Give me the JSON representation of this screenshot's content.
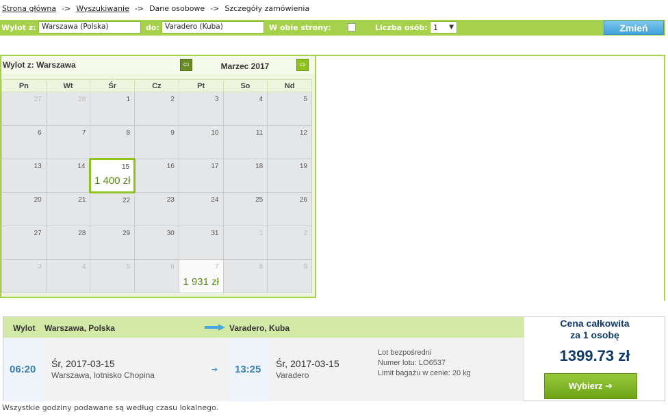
{
  "breadcrumb": {
    "home": "Strona główna",
    "search": "Wyszukiwanie",
    "personal": "Dane osobowe",
    "order": "Szczegóły zamówienia",
    "separator": "->"
  },
  "searchbar": {
    "from_label": "Wylot z:",
    "from_value": "Warszawa (Polska)",
    "to_label": "do:",
    "to_value": "Varadero (Kuba)",
    "roundtrip_label": "W obie strony:",
    "roundtrip_checked": false,
    "persons_label": "Liczba osób:",
    "persons_value": "1",
    "change_button": "Zmień"
  },
  "calendar": {
    "from_label": "Wylot z: Warszawa",
    "month": "Marzec 2017",
    "weekdays": [
      "Pn",
      "Wt",
      "Śr",
      "Cz",
      "Pt",
      "So",
      "Nd"
    ],
    "weeks": [
      [
        {
          "d": "27",
          "o": true
        },
        {
          "d": "28",
          "o": true
        },
        {
          "d": "1"
        },
        {
          "d": "2"
        },
        {
          "d": "3"
        },
        {
          "d": "4"
        },
        {
          "d": "5"
        }
      ],
      [
        {
          "d": "6"
        },
        {
          "d": "7"
        },
        {
          "d": "8"
        },
        {
          "d": "9"
        },
        {
          "d": "10"
        },
        {
          "d": "11"
        },
        {
          "d": "12"
        }
      ],
      [
        {
          "d": "13"
        },
        {
          "d": "14"
        },
        {
          "d": "15",
          "price": "1 400 zł",
          "sel": true
        },
        {
          "d": "16"
        },
        {
          "d": "17"
        },
        {
          "d": "18"
        },
        {
          "d": "19"
        }
      ],
      [
        {
          "d": "20"
        },
        {
          "d": "21"
        },
        {
          "d": "22"
        },
        {
          "d": "23"
        },
        {
          "d": "24"
        },
        {
          "d": "25"
        },
        {
          "d": "26"
        }
      ],
      [
        {
          "d": "27"
        },
        {
          "d": "28"
        },
        {
          "d": "29"
        },
        {
          "d": "30"
        },
        {
          "d": "31"
        },
        {
          "d": "1",
          "o": true
        },
        {
          "d": "2",
          "o": true
        }
      ],
      [
        {
          "d": "3",
          "o": true
        },
        {
          "d": "4",
          "o": true
        },
        {
          "d": "5",
          "o": true
        },
        {
          "d": "6",
          "o": true
        },
        {
          "d": "7",
          "o": true,
          "price": "1 931 zł",
          "priced": true
        },
        {
          "d": "8",
          "o": true
        },
        {
          "d": "9",
          "o": true
        }
      ]
    ]
  },
  "flight": {
    "direction_label": "Wylot",
    "from_city": "Warszawa, Polska",
    "to_city": "Varadero, Kuba",
    "dep_time": "06:20",
    "dep_date": "Śr, 2017-03-15",
    "dep_place": "Warszawa, lotnisko Chopina",
    "arr_time": "13:25",
    "arr_date": "Śr, 2017-03-15",
    "arr_place": "Varadero",
    "direct": "Lot bezpośredni",
    "flight_no": "Numer lotu: LO6537",
    "baggage": "Limit bagażu w cenie: 20 kg",
    "price_title_1": "Cena całkowita",
    "price_title_2": "za 1 osobę",
    "price": "1399.73 zł",
    "select_button": "Wybierz"
  },
  "footer_note": "Wszystkie godziny podawane są według czasu lokalnego.",
  "colors": {
    "accent_green": "#a6d14a",
    "button_blue": "#3ea2d6",
    "price_navy": "#0f3a6a"
  }
}
